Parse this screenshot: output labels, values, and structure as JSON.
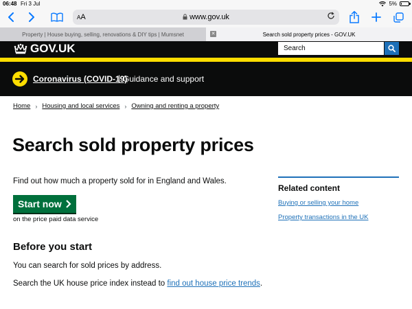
{
  "status_bar": {
    "time": "06:48",
    "date": "Fri 3 Jul",
    "battery": "5%",
    "battery_level": 0.05
  },
  "browser": {
    "aa_small": "A",
    "aa_large": "A",
    "url": "www.gov.uk",
    "tabs": [
      {
        "label": "Property | House buying, selling, renovations & DIY tips | Mumsnet",
        "active": false
      },
      {
        "label": "Search sold property prices - GOV.UK",
        "active": true
      }
    ]
  },
  "header": {
    "logo_text": "GOV.UK",
    "search_placeholder": "Search"
  },
  "banner": {
    "link": "Coronavirus (COVID-19)",
    "separator": "|",
    "text": "Guidance and support"
  },
  "breadcrumb": [
    "Home",
    "Housing and local services",
    "Owning and renting a property"
  ],
  "main": {
    "title": "Search sold property prices",
    "intro": "Find out how much a property sold for in England and Wales.",
    "start_button": "Start now",
    "start_caption": "on the price paid data service",
    "before_heading": "Before you start",
    "para1": "You can search for sold prices by address.",
    "para2_prefix": "Search the UK house price index instead to ",
    "para2_link": "find out house price trends",
    "para2_suffix": "."
  },
  "related": {
    "title": "Related content",
    "links": [
      "Buying or selling your home",
      "Property transactions in the UK"
    ]
  },
  "colors": {
    "gov_black": "#0b0c0c",
    "gov_yellow": "#ffdd00",
    "link_blue": "#1d70b8",
    "start_green": "#00703c",
    "ios_blue": "#0a7aff"
  }
}
